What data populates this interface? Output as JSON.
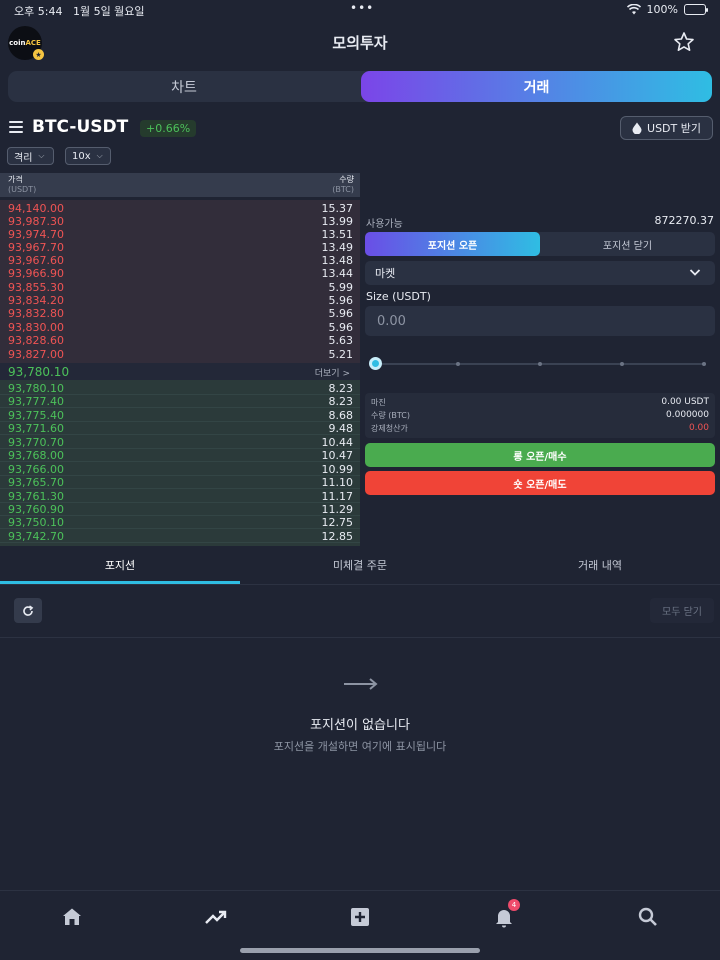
{
  "status_bar": {
    "time": "오후 5:44",
    "date": "1월 5일 월요일",
    "dots": "•••",
    "battery": "100%"
  },
  "header": {
    "logo_text": "coin",
    "logo_accent": "ACE",
    "title": "모의투자"
  },
  "segment": {
    "chart": "차트",
    "trade": "거래"
  },
  "symbol": {
    "name": "BTC-USDT",
    "change": "+0.66%",
    "receive_btn": "USDT 받기"
  },
  "selectors": {
    "margin_mode": "격리",
    "leverage": "10x"
  },
  "orderbook": {
    "price_header": "가격",
    "price_unit": "(USDT)",
    "qty_header": "수량",
    "qty_unit": "(BTC)",
    "asks": [
      {
        "price": "94,140.00",
        "qty": "15.37"
      },
      {
        "price": "93,987.30",
        "qty": "13.99"
      },
      {
        "price": "93,974.70",
        "qty": "13.51"
      },
      {
        "price": "93,967.70",
        "qty": "13.49"
      },
      {
        "price": "93,967.60",
        "qty": "13.48"
      },
      {
        "price": "93,966.90",
        "qty": "13.44"
      },
      {
        "price": "93,855.30",
        "qty": "5.99"
      },
      {
        "price": "93,834.20",
        "qty": "5.96"
      },
      {
        "price": "93,832.80",
        "qty": "5.96"
      },
      {
        "price": "93,830.00",
        "qty": "5.96"
      },
      {
        "price": "93,828.60",
        "qty": "5.63"
      },
      {
        "price": "93,827.00",
        "qty": "5.21"
      }
    ],
    "mid_price": "93,780.10",
    "more": "더보기 >",
    "bids": [
      {
        "price": "93,780.10",
        "qty": "8.23"
      },
      {
        "price": "93,777.40",
        "qty": "8.23"
      },
      {
        "price": "93,775.40",
        "qty": "8.68"
      },
      {
        "price": "93,771.60",
        "qty": "9.48"
      },
      {
        "price": "93,770.70",
        "qty": "10.44"
      },
      {
        "price": "93,768.00",
        "qty": "10.47"
      },
      {
        "price": "93,766.00",
        "qty": "10.99"
      },
      {
        "price": "93,765.70",
        "qty": "11.10"
      },
      {
        "price": "93,761.30",
        "qty": "11.17"
      },
      {
        "price": "93,760.90",
        "qty": "11.29"
      },
      {
        "price": "93,750.10",
        "qty": "12.75"
      },
      {
        "price": "93,742.70",
        "qty": "12.85"
      }
    ]
  },
  "order_form": {
    "available_label": "사용가능",
    "available_value": "872270.37",
    "open_tab": "포지션 오픈",
    "close_tab": "포지션 닫기",
    "order_type": "마켓",
    "size_label": "Size (USDT)",
    "size_placeholder": "0.00",
    "margin_label": "마진",
    "margin_value": "0.00 USDT",
    "qty_label": "수량 (BTC)",
    "qty_value": "0.000000",
    "liq_label": "강제청산가",
    "liq_value": "0.00",
    "long_btn": "롱 오픈/매수",
    "short_btn": "숏 오픈/매도"
  },
  "positions": {
    "tabs": [
      "포지션",
      "미체결 주문",
      "거래 내역"
    ],
    "close_all": "모두 닫기",
    "empty_title": "포지션이 없습니다",
    "empty_sub": "포지션을 개설하면 여기에 표시됩니다"
  },
  "tabbar": {
    "notification_count": "4"
  },
  "colors": {
    "ask": "#ef5454",
    "bid": "#4cc15a",
    "accent": "#2fbde3",
    "purple": "#7b45e8"
  }
}
